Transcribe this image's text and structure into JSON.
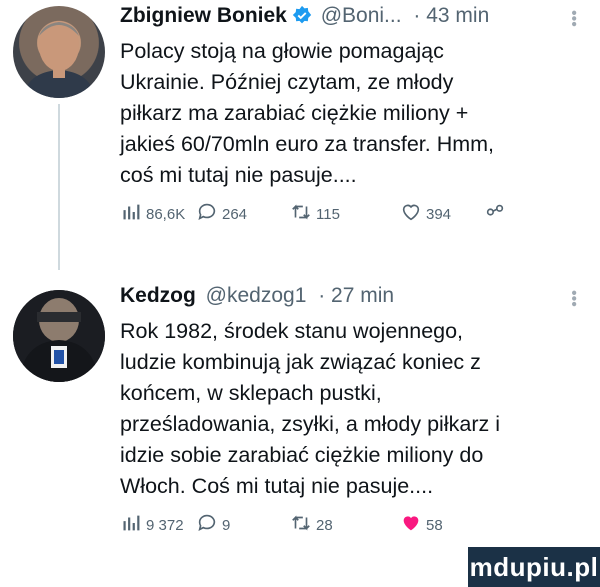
{
  "tweets": [
    {
      "author": "Zbigniew Boniek",
      "handle": "@Boni...",
      "time": "· 43 min",
      "verified": true,
      "text_lines": [
        "Polacy stoją na głowie pomagając",
        "Ukrainie. Później czytam, ze młody",
        "piłkarz ma zarabiać ciężkie miliony +",
        "jakieś 60/70mln euro za transfer. Hmm,",
        "coś mi tutaj nie pasuje...."
      ],
      "views": "86,6K",
      "replies": "264",
      "retweets": "115",
      "likes": "394"
    },
    {
      "author": "Kedzog",
      "handle": "@kedzog1",
      "time": "· 27 min",
      "verified": false,
      "text_lines": [
        "Rok 1982, środek stanu wojennego,",
        "ludzie kombinują jak związać koniec z",
        "końcem, w sklepach pustki,",
        "prześladowania, zsyłki, a młody piłkarz i",
        "idzie sobie zarabiać ciężkie miliony do",
        "Włoch. Coś mi tutaj nie pasuje...."
      ],
      "views": "9 372",
      "replies": "9",
      "retweets": "28",
      "likes": "58"
    }
  ],
  "watermark": "mdupiu.pl",
  "colors": {
    "text": "#0f1419",
    "meta": "#536471",
    "verified": "#1d9bf0",
    "like_filled": "#f91880"
  },
  "icons": [
    "verified-badge-icon",
    "more-icon",
    "views-icon",
    "reply-icon",
    "retweet-icon",
    "like-icon",
    "share-icon"
  ]
}
